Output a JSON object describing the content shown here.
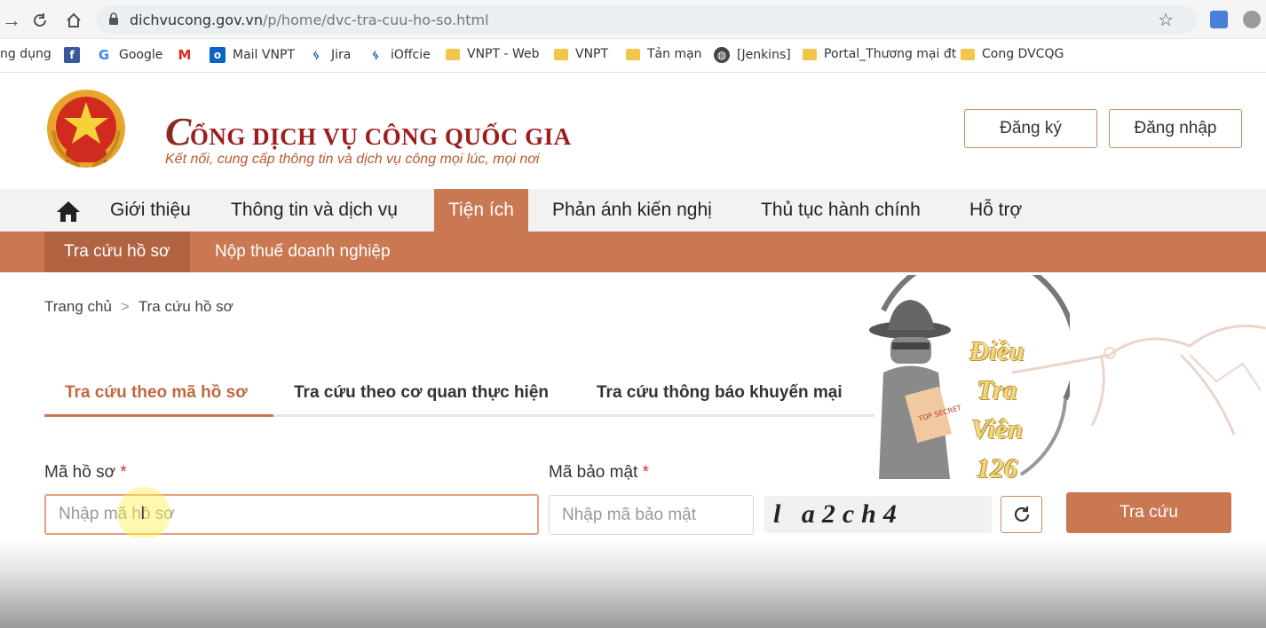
{
  "browser": {
    "url_host": "dichvucong.gov.vn",
    "url_path": "/p/home/dvc-tra-cuu-ho-so.html",
    "bookmarks": [
      {
        "label": "ng dụng",
        "icon": "apps-icon"
      },
      {
        "label": "",
        "icon": "facebook-icon"
      },
      {
        "label": "Google",
        "icon": "google-icon"
      },
      {
        "label": "",
        "icon": "gmail-icon"
      },
      {
        "label": "Mail VNPT",
        "icon": "outlook-icon"
      },
      {
        "label": "Jira",
        "icon": "jira-icon"
      },
      {
        "label": "iOffcie",
        "icon": "ioffice-icon"
      },
      {
        "label": "VNPT - Web",
        "icon": "folder-icon"
      },
      {
        "label": "VNPT",
        "icon": "folder-icon"
      },
      {
        "label": "Tản mạn",
        "icon": "folder-icon"
      },
      {
        "label": "[Jenkins]",
        "icon": "globe-icon"
      },
      {
        "label": "Portal_Thương mại đt",
        "icon": "folder-icon"
      },
      {
        "label": "Cong DVCQG",
        "icon": "folder-icon"
      }
    ]
  },
  "header": {
    "title_initial": "C",
    "title_rest": "ỔNG DỊCH VỤ CÔNG QUỐC GIA",
    "slogan": "Kết nối, cung cấp thông tin và dịch vụ công mọi lúc, mọi nơi",
    "register_label": "Đăng ký",
    "login_label": "Đăng nhập"
  },
  "menu": {
    "items": [
      {
        "label": "Giới thiệu"
      },
      {
        "label": "Thông tin và dịch vụ"
      },
      {
        "label": "Tiện ích",
        "active": true
      },
      {
        "label": "Phản ánh kiến nghị"
      },
      {
        "label": "Thủ tục hành chính"
      },
      {
        "label": "Hỗ trợ"
      }
    ],
    "sub_items": [
      {
        "label": "Tra cứu hồ sơ",
        "active": true
      },
      {
        "label": "Nộp thuế doanh nghiệp"
      }
    ]
  },
  "breadcrumb": {
    "home": "Trang chủ",
    "separator": ">",
    "current": "Tra cứu hồ sơ"
  },
  "tabs": [
    {
      "label": "Tra cứu theo mã hồ sơ",
      "active": true
    },
    {
      "label": "Tra cứu theo cơ quan thực hiện"
    },
    {
      "label": "Tra cứu thông báo khuyến mại"
    }
  ],
  "form": {
    "file_code_label": "Mã hồ sơ",
    "file_code_placeholder": "Nhập mã hồ sơ",
    "security_code_label": "Mã bảo mật",
    "security_code_placeholder": "Nhập mã bảo mật",
    "required_mark": "*",
    "captcha_text": "l a2ch4",
    "submit_label": "Tra cứu"
  },
  "watermark": {
    "lines": [
      "Điều",
      "Tra",
      "Viên",
      "126"
    ]
  },
  "colors": {
    "accent": "#c97852",
    "accent_dark": "#b26341",
    "title_red": "#9c1e1e"
  }
}
